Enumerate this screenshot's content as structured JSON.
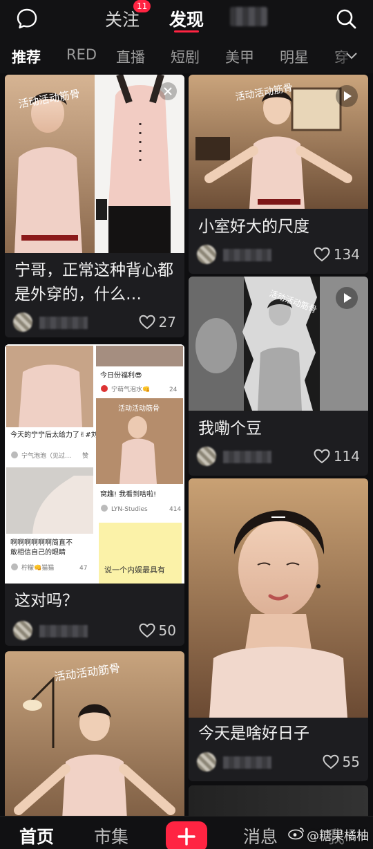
{
  "header": {
    "tabs": [
      {
        "label": "关注",
        "badge": "11"
      },
      {
        "label": "发现"
      }
    ],
    "active_tab": "发现",
    "accent_color": "#ff2442"
  },
  "channels": {
    "items": [
      "推荐",
      "RED",
      "直播",
      "短剧",
      "美甲",
      "明星",
      "穿"
    ],
    "active": "推荐"
  },
  "feed": {
    "cards": [
      {
        "title": "宁哥，正常这种背心都是外穿的，什么…",
        "image_text": "活动活动筋骨",
        "likes": "27",
        "type": "image"
      },
      {
        "title": "小室好大的尺度",
        "image_text": "活动活动筋骨",
        "likes": "134",
        "type": "video"
      },
      {
        "title": "这对吗？",
        "likes": "50",
        "type": "image",
        "inner_posts": [
          {
            "title": "今天的宁宁后太给力了✌#刘宇宁 #永远为之…",
            "author": "宁气泡泡（见过…",
            "likes": "赞"
          },
          {
            "title": "今日份福利😎",
            "author": "宁萌气泡水👊",
            "likes": "24"
          },
          {
            "title": "窝趣! 我看到啥啦!",
            "author": "LYN-Studies",
            "likes": "414",
            "image_text": "活动活动筋骨"
          },
          {
            "title": "啊啊啊啊啊啊简直不敢相信自己的眼睛",
            "author": "柠檬👊猫猫",
            "likes": "47"
          },
          {
            "title": "说一个内娱最具有",
            "image_text": "说一个内娱最具有"
          }
        ]
      },
      {
        "title": "我嘞个豆",
        "image_text": "活动活动筋骨",
        "likes": "114",
        "type": "video"
      },
      {
        "title": "",
        "image_text": "活动活动筋骨",
        "type": "image"
      },
      {
        "title": "今天是啥好日子",
        "likes": "55",
        "type": "image"
      }
    ]
  },
  "bottom_nav": {
    "items": [
      "首页",
      "市集",
      "消息",
      "我"
    ],
    "active": "首页",
    "post_icon": "plus-icon"
  },
  "watermark": "@糖果橘柚"
}
